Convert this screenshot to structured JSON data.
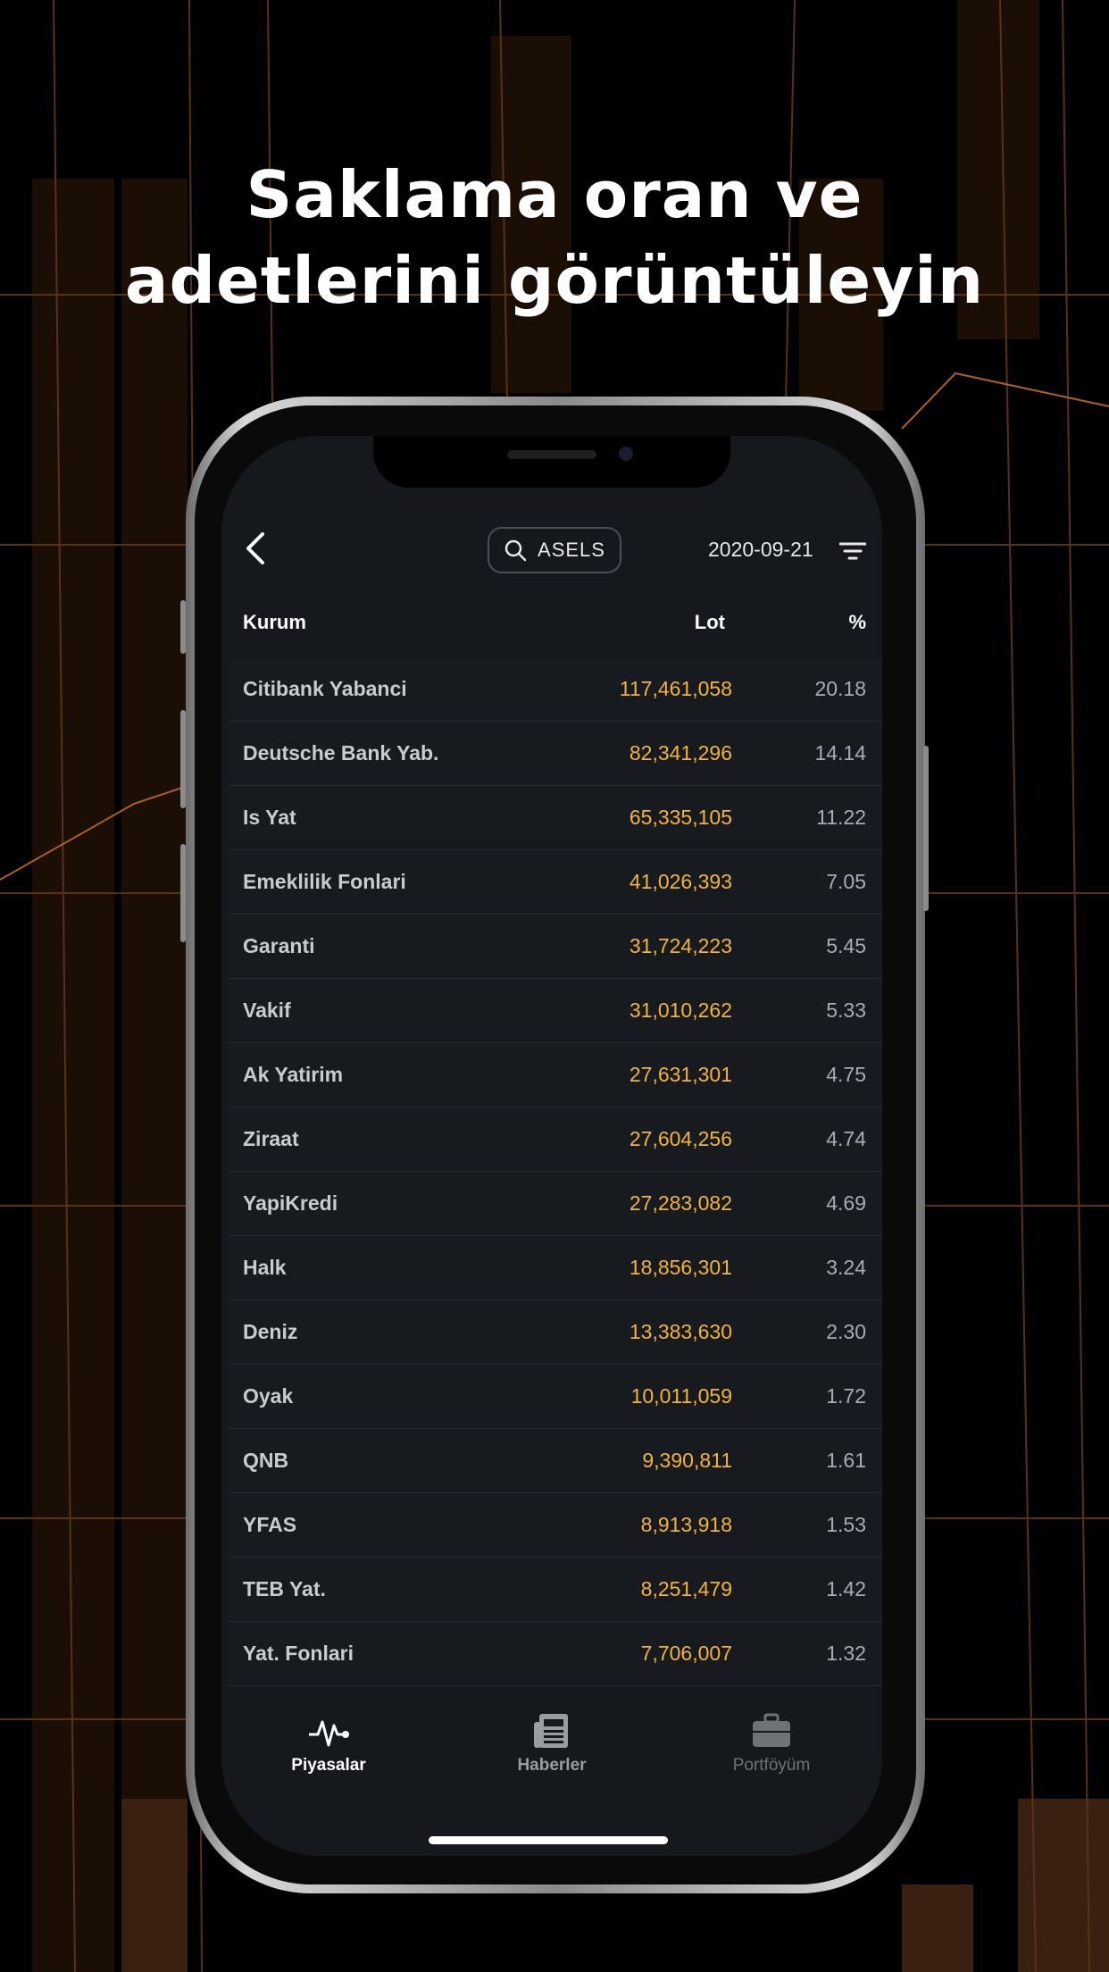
{
  "headline": {
    "line1": "Saklama oran ve",
    "line2": "adetlerini görüntüleyin"
  },
  "header": {
    "back_icon": "chevron-left-icon",
    "search_label": "ASELS",
    "date": "2020-09-21",
    "filter_icon": "filter-icon"
  },
  "table": {
    "columns": [
      "Kurum",
      "Lot",
      "%"
    ],
    "rows": [
      {
        "name": "Citibank Yabanci",
        "lot": "117,461,058",
        "pct": "20.18"
      },
      {
        "name": "Deutsche Bank Yab.",
        "lot": "82,341,296",
        "pct": "14.14"
      },
      {
        "name": "Is Yat",
        "lot": "65,335,105",
        "pct": "11.22"
      },
      {
        "name": "Emeklilik Fonlari",
        "lot": "41,026,393",
        "pct": "7.05"
      },
      {
        "name": "Garanti",
        "lot": "31,724,223",
        "pct": "5.45"
      },
      {
        "name": "Vakif",
        "lot": "31,010,262",
        "pct": "5.33"
      },
      {
        "name": "Ak Yatirim",
        "lot": "27,631,301",
        "pct": "4.75"
      },
      {
        "name": "Ziraat",
        "lot": "27,604,256",
        "pct": "4.74"
      },
      {
        "name": "YapiKredi",
        "lot": "27,283,082",
        "pct": "4.69"
      },
      {
        "name": "Halk",
        "lot": "18,856,301",
        "pct": "3.24"
      },
      {
        "name": "Deniz",
        "lot": "13,383,630",
        "pct": "2.30"
      },
      {
        "name": "Oyak",
        "lot": "10,011,059",
        "pct": "1.72"
      },
      {
        "name": "QNB",
        "lot": "9,390,811",
        "pct": "1.61"
      },
      {
        "name": "YFAS",
        "lot": "8,913,918",
        "pct": "1.53"
      },
      {
        "name": "TEB Yat.",
        "lot": "8,251,479",
        "pct": "1.42"
      },
      {
        "name": "Yat. Fonlari",
        "lot": "7,706,007",
        "pct": "1.32"
      }
    ]
  },
  "tabbar": {
    "tabs": [
      {
        "label": "Piyasalar",
        "icon": "pulse-icon",
        "active": true
      },
      {
        "label": "Haberler",
        "icon": "newspaper-icon",
        "active": false
      },
      {
        "label": "Portföyüm",
        "icon": "briefcase-icon",
        "active": false
      }
    ]
  },
  "colors": {
    "accent_lot": "#f2b43b",
    "background": "#000000",
    "screen": "#15181d",
    "bg_lines": "#8a4b14"
  }
}
